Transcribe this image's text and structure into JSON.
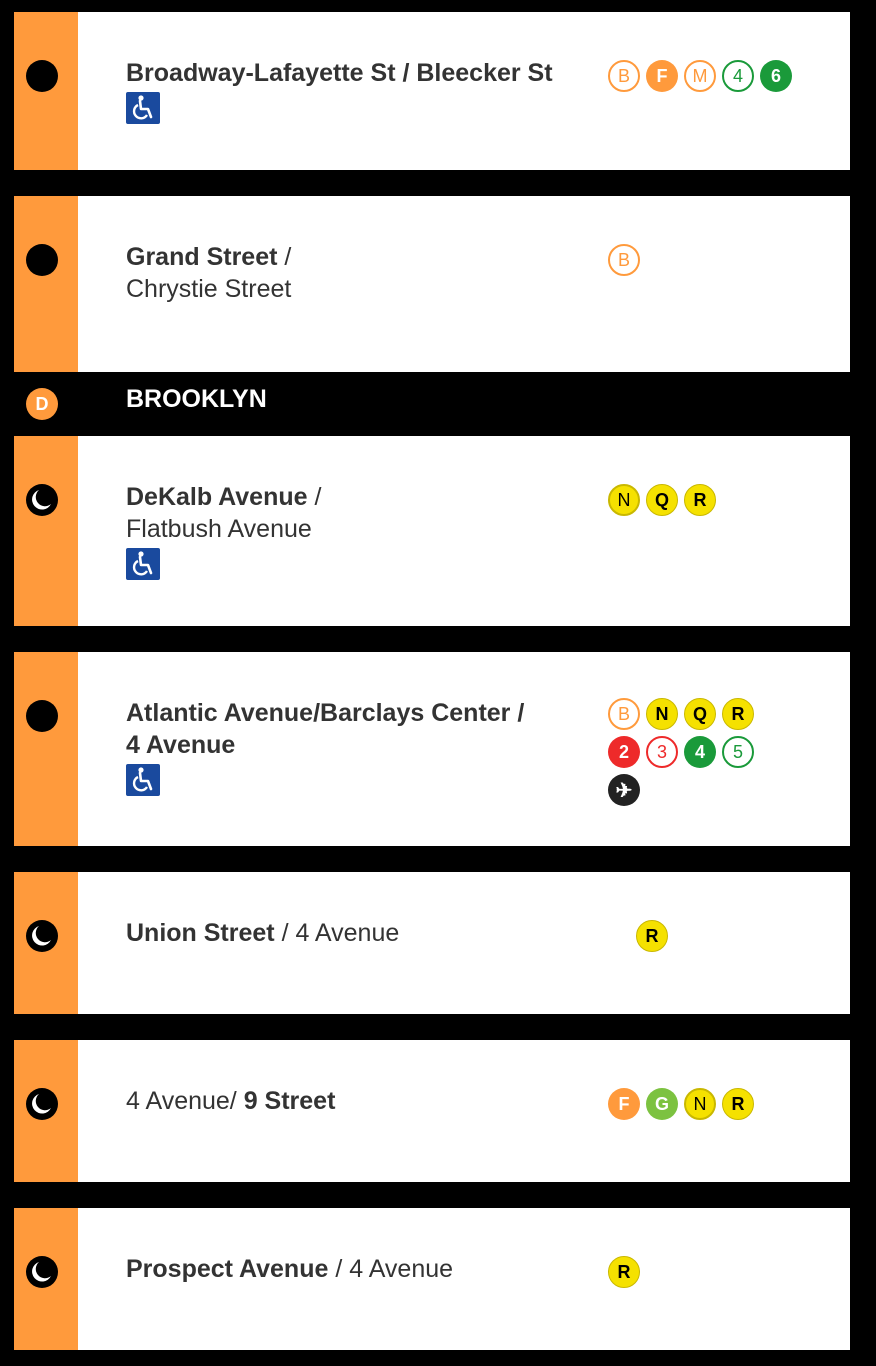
{
  "section": {
    "bullet": "D",
    "title": "BROOKLYN"
  },
  "stations": [
    {
      "name_bold": "Broadway-Lafayette St / Bleecker St",
      "name_rest": "",
      "name_line2_bold": "",
      "name_line2": "",
      "accessible": true,
      "late_night_only": false,
      "bullets": [
        {
          "t": "B",
          "style": "outline",
          "color": "#ff9a3c"
        },
        {
          "t": "F",
          "style": "solid",
          "color": "#ff9a3c"
        },
        {
          "t": "M",
          "style": "outline",
          "color": "#ff9a3c"
        },
        {
          "t": "4",
          "style": "outline",
          "color": "#1a9a3a"
        },
        {
          "t": "6",
          "style": "solid",
          "color": "#1a9a3a"
        }
      ]
    },
    {
      "name_bold": "Grand Street",
      "name_rest": " /",
      "name_line2_bold": "",
      "name_line2": "Chrystie Street",
      "accessible": false,
      "late_night_only": false,
      "bullets": [
        {
          "t": "B",
          "style": "outline",
          "color": "#ff9a3c"
        }
      ]
    },
    {
      "name_bold": "DeKalb Avenue",
      "name_rest": " /",
      "name_line2_bold": "",
      "name_line2": "Flatbush Avenue",
      "accessible": true,
      "late_night_only": true,
      "bullets": [
        {
          "t": "N",
          "style": "outline",
          "color": "#f5e100"
        },
        {
          "t": "Q",
          "style": "solid",
          "color": "#f5e100"
        },
        {
          "t": "R",
          "style": "solid",
          "color": "#f5e100"
        }
      ]
    },
    {
      "name_bold": "Atlantic Avenue/Barclays Center /",
      "name_rest": "",
      "name_line2_bold": "4 Avenue",
      "name_line2": "",
      "accessible": true,
      "late_night_only": false,
      "bullets": [
        {
          "t": "B",
          "style": "outline",
          "color": "#ff9a3c"
        },
        {
          "t": "N",
          "style": "solid",
          "color": "#f5e100"
        },
        {
          "t": "Q",
          "style": "solid",
          "color": "#f5e100"
        },
        {
          "t": "R",
          "style": "solid",
          "color": "#f5e100"
        },
        {
          "t": "2",
          "style": "solid",
          "color": "#ee2a2a"
        },
        {
          "t": "3",
          "style": "outline",
          "color": "#ee2a2a"
        },
        {
          "t": "4",
          "style": "solid",
          "color": "#1a9a3a"
        },
        {
          "t": "5",
          "style": "outline",
          "color": "#1a9a3a"
        },
        {
          "t": "✈",
          "style": "solid",
          "color": "#222222"
        }
      ]
    },
    {
      "name_bold": "Union Street",
      "name_rest": " / 4 Avenue",
      "name_line2_bold": "",
      "name_line2": "",
      "accessible": false,
      "late_night_only": true,
      "bullets": [
        {
          "t": "R",
          "style": "solid",
          "color": "#f5e100"
        }
      ]
    },
    {
      "name_bold": "",
      "name_rest": "4 Avenue/ ",
      "name_tail_bold": "9 Street",
      "name_line2_bold": "",
      "name_line2": "",
      "accessible": false,
      "late_night_only": true,
      "bullets": [
        {
          "t": "F",
          "style": "solid",
          "color": "#ff9a3c"
        },
        {
          "t": "G",
          "style": "solid",
          "color": "#7cc240"
        },
        {
          "t": "N",
          "style": "outline",
          "color": "#f5e100"
        },
        {
          "t": "R",
          "style": "solid",
          "color": "#f5e100"
        }
      ]
    },
    {
      "name_bold": "Prospect Avenue",
      "name_rest": " / 4 Avenue",
      "name_line2_bold": "",
      "name_line2": "",
      "accessible": false,
      "late_night_only": true,
      "bullets": [
        {
          "t": "R",
          "style": "solid",
          "color": "#f5e100"
        }
      ]
    }
  ]
}
